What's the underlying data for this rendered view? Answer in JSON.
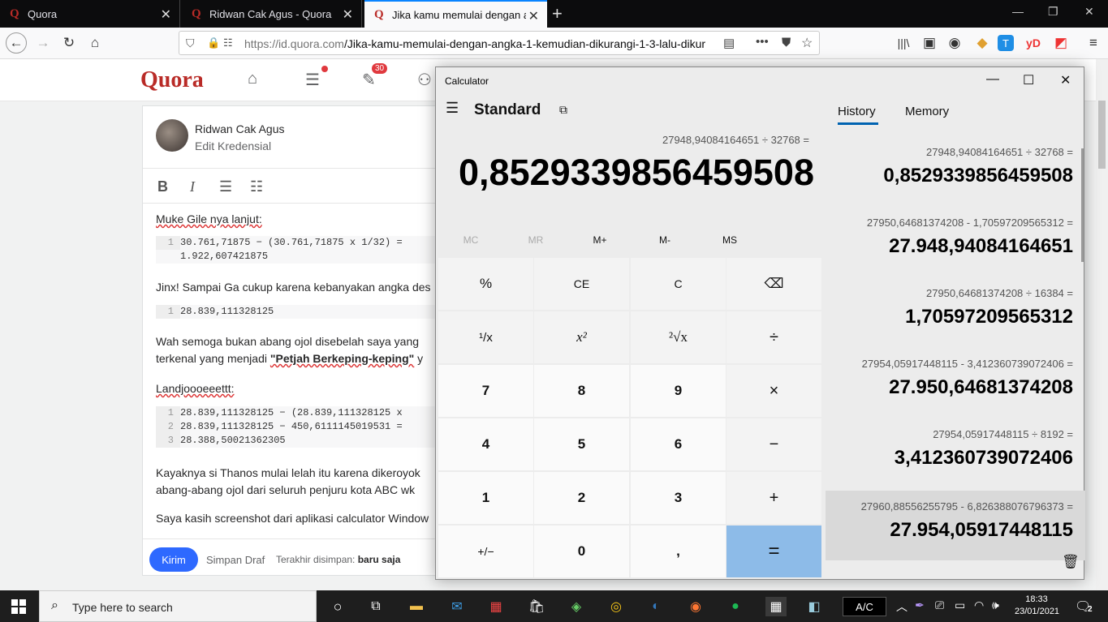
{
  "browser": {
    "tabs": [
      {
        "title": "Quora",
        "favicon": "Q"
      },
      {
        "title": "Ridwan Cak Agus - Quora",
        "favicon": "Q"
      },
      {
        "title": "Jika kamu memulai dengan an",
        "favicon": "Q"
      }
    ],
    "url_host": "https://id.quora.com",
    "url_path": "/Jika-kamu-memulai-dengan-angka-1-kemudian-dikurangi-1-3-lalu-dikur"
  },
  "quora": {
    "logo": "Quora",
    "notif_count": "30",
    "author_name": "Ridwan Cak Agus",
    "author_cred": "Edit Kredensial",
    "p1": "Muke Gile nya lanjut:",
    "code1": [
      {
        "n": "1",
        "t": "30.761,71875 − (30.761,71875 x 1/32) ="
      },
      {
        "n": "",
        "t": "1.922,607421875"
      }
    ],
    "p2": "Jinx! Sampai Ga cukup karena kebanyakan angka des",
    "code2": [
      {
        "n": "1",
        "t": "28.839,111328125"
      }
    ],
    "p3a": "Wah semoga bukan abang ojol disebelah saya yang",
    "p3b_pre": "terkenal yang menjadi ",
    "p3b_bold": "\"Petjah Berkeping-keping\"",
    "p3b_post": " y",
    "p4": "Landjoooeeettt:",
    "code3": [
      {
        "n": "1",
        "t": "28.839,111328125 − (28.839,111328125 x"
      },
      {
        "n": "2",
        "t": "28.839,111328125 − 450,6111145019531 ="
      },
      {
        "n": "3",
        "t": "28.388,50021362305"
      }
    ],
    "p5a": "Kayaknya si Thanos mulai lelah itu karena dikeroyok",
    "p5b": "abang-abang ojol dari seluruh penjuru kota ABC wk",
    "p6": "Saya kasih screenshot dari aplikasi calculator Window",
    "submit": "Kirim",
    "save_draft": "Simpan Draf",
    "last_saved_label": "Terakhir disimpan:",
    "last_saved_value": "baru saja"
  },
  "calculator": {
    "window_title": "Calculator",
    "mode": "Standard",
    "expression": "27948,94084164651 ÷ 32768 =",
    "display": "0,8529339856459508",
    "memory_buttons": [
      "MC",
      "MR",
      "M+",
      "M-",
      "MS"
    ],
    "keys": [
      [
        "%",
        "CE",
        "C",
        "⌫"
      ],
      [
        "¹/x",
        "x²",
        "²√x",
        "÷"
      ],
      [
        "7",
        "8",
        "9",
        "×"
      ],
      [
        "4",
        "5",
        "6",
        "−"
      ],
      [
        "1",
        "2",
        "3",
        "+"
      ],
      [
        "+/−",
        "0",
        ",",
        "="
      ]
    ],
    "history_tab": "History",
    "memory_tab": "Memory",
    "history": [
      {
        "expr": "27948,94084164651   ÷   32768 =",
        "result": "0,8529339856459508"
      },
      {
        "expr": "27950,64681374208   -   1,70597209565312 =",
        "result": "27.948,94084164651"
      },
      {
        "expr": "27950,64681374208   ÷   16384 =",
        "result": "1,70597209565312"
      },
      {
        "expr": "27954,05917448115   -   3,412360739072406 =",
        "result": "27.950,64681374208"
      },
      {
        "expr": "27954,05917448115   ÷   8192 =",
        "result": "3,412360739072406"
      },
      {
        "expr": "27960,88556255795   -   6,826388076796373 =",
        "result": "27.954,05917448115"
      }
    ]
  },
  "taskbar": {
    "search_placeholder": "Type here to search",
    "ac_label": "A/C",
    "time": "18:33",
    "date": "23/01/2021",
    "notif_count": "2"
  }
}
